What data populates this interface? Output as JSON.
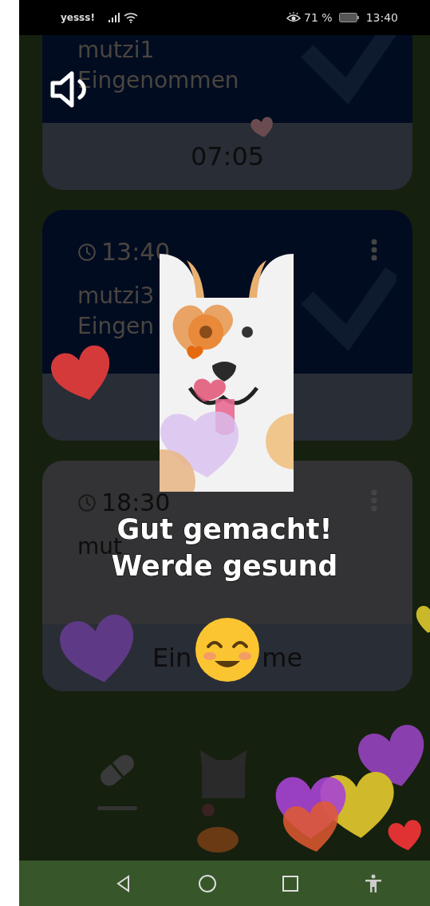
{
  "status_bar": {
    "carrier": "yesss!",
    "battery": "71 %",
    "time": "13:40"
  },
  "reminders": [
    {
      "kind": "taken",
      "name": "mutzi1",
      "status": "Eingenommen",
      "footer": "07:05"
    },
    {
      "kind": "taken",
      "time": "13:40",
      "name": "mutzi3",
      "status": "Eingen"
    },
    {
      "kind": "pending",
      "time": "18:30",
      "name": "mut",
      "action": [
        "Ein",
        "me"
      ]
    }
  ],
  "celebration": {
    "message": [
      "Gut gemacht!",
      "Werde gesund"
    ]
  },
  "bottom_nav": {
    "tabs": [
      {
        "kind": "pill",
        "selected": true
      },
      {
        "kind": "cat",
        "selected": false
      }
    ]
  }
}
